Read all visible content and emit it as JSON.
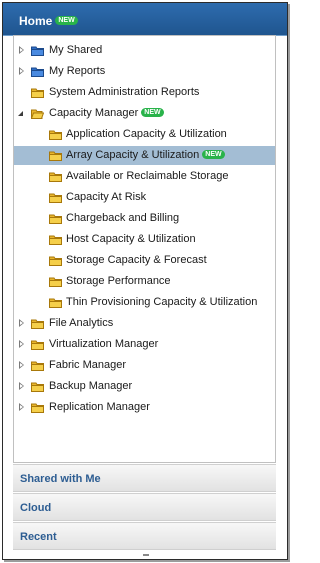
{
  "header": {
    "title": "Home",
    "badge": "NEW"
  },
  "tree": {
    "items": [
      {
        "label": "My Shared",
        "icon": "blue-folder-icon",
        "toggle": "collapsed"
      },
      {
        "label": "My Reports",
        "icon": "blue-folder-icon",
        "toggle": "collapsed"
      },
      {
        "label": "System Administration Reports",
        "icon": "folder-icon",
        "toggle": "none"
      },
      {
        "label": "Capacity Manager",
        "icon": "open-folder-icon",
        "toggle": "expanded",
        "badge": "NEW"
      },
      {
        "label": "Application Capacity & Utilization",
        "icon": "folder-icon"
      },
      {
        "label": "Array Capacity & Utilization",
        "icon": "folder-icon",
        "badge": "NEW",
        "selected": true
      },
      {
        "label": "Available or Reclaimable Storage",
        "icon": "folder-icon"
      },
      {
        "label": "Capacity At Risk",
        "icon": "folder-icon"
      },
      {
        "label": "Chargeback and Billing",
        "icon": "folder-icon"
      },
      {
        "label": "Host Capacity & Utilization",
        "icon": "folder-icon"
      },
      {
        "label": "Storage Capacity & Forecast",
        "icon": "folder-icon"
      },
      {
        "label": "Storage Performance",
        "icon": "folder-icon"
      },
      {
        "label": "Thin Provisioning Capacity & Utilization",
        "icon": "folder-icon"
      },
      {
        "label": "File Analytics",
        "icon": "folder-icon",
        "toggle": "collapsed"
      },
      {
        "label": "Virtualization Manager",
        "icon": "folder-icon",
        "toggle": "collapsed"
      },
      {
        "label": "Fabric Manager",
        "icon": "folder-icon",
        "toggle": "collapsed"
      },
      {
        "label": "Backup Manager",
        "icon": "folder-icon",
        "toggle": "collapsed"
      },
      {
        "label": "Replication Manager",
        "icon": "folder-icon",
        "toggle": "collapsed"
      }
    ]
  },
  "sections": [
    {
      "label": "Shared with Me"
    },
    {
      "label": "Cloud"
    },
    {
      "label": "Recent"
    }
  ],
  "colors": {
    "header": "#1f558f",
    "selected_row": "#a3bdd4",
    "new_badge": "#29b34a",
    "section_text": "#2d5d92"
  }
}
